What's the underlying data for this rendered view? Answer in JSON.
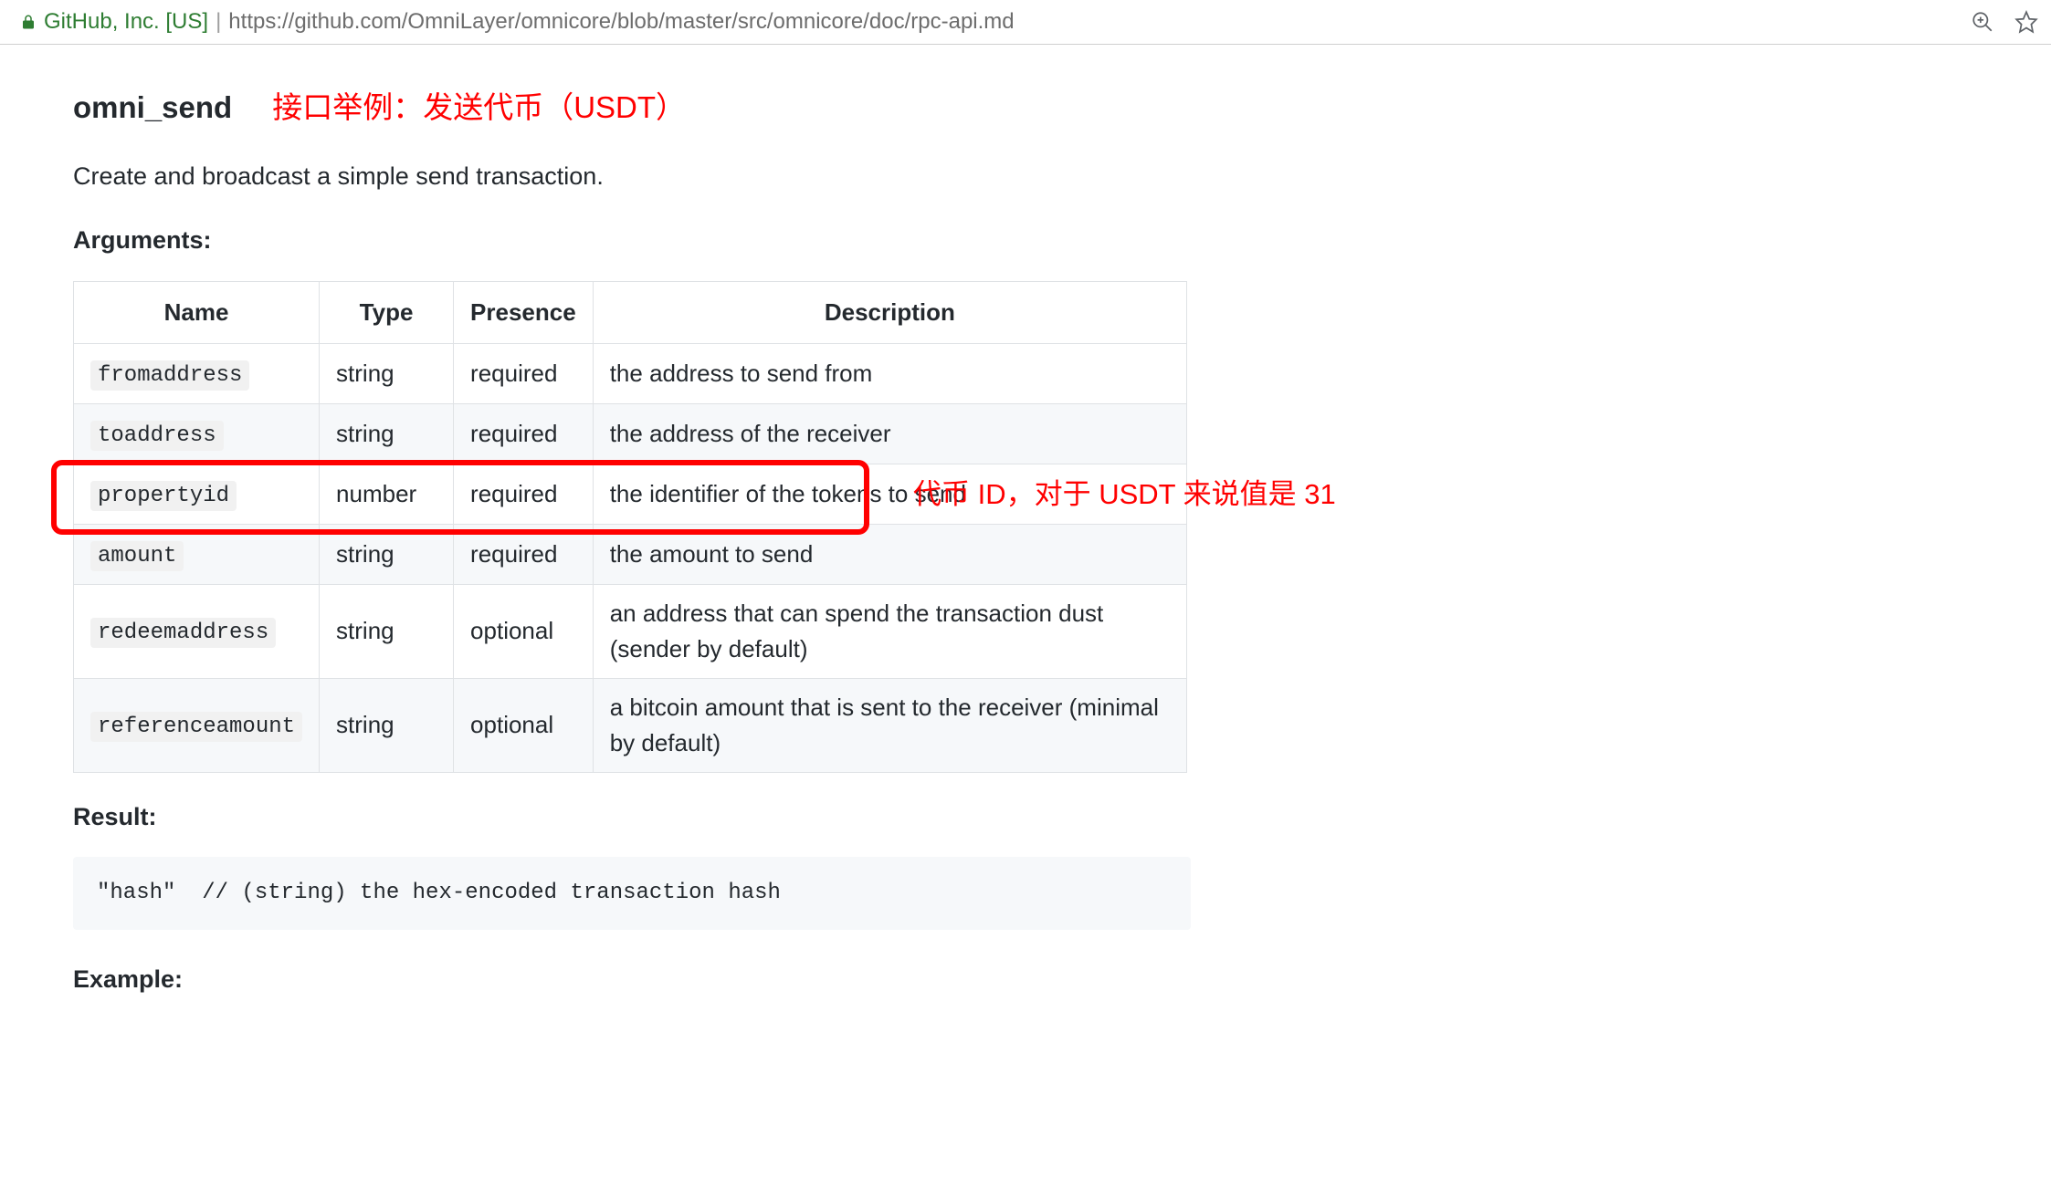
{
  "browser": {
    "company": "GitHub, Inc. [US]",
    "url": "https://github.com/OmniLayer/omnicore/blob/master/src/omnicore/doc/rpc-api.md"
  },
  "heading": {
    "api": "omni_send",
    "annotation": "接口举例：发送代币（USDT）"
  },
  "description": "Create and broadcast a simple send transaction.",
  "labels": {
    "arguments": "Arguments:",
    "result": "Result:",
    "example": "Example:"
  },
  "table": {
    "headers": {
      "name": "Name",
      "type": "Type",
      "presence": "Presence",
      "description": "Description"
    },
    "rows": [
      {
        "name": "fromaddress",
        "type": "string",
        "presence": "required",
        "description": "the address to send from"
      },
      {
        "name": "toaddress",
        "type": "string",
        "presence": "required",
        "description": "the address of the receiver"
      },
      {
        "name": "propertyid",
        "type": "number",
        "presence": "required",
        "description": "the identifier of the tokens to send"
      },
      {
        "name": "amount",
        "type": "string",
        "presence": "required",
        "description": "the amount to send"
      },
      {
        "name": "redeemaddress",
        "type": "string",
        "presence": "optional",
        "description": "an address that can spend the transaction dust (sender by default)"
      },
      {
        "name": "referenceamount",
        "type": "string",
        "presence": "optional",
        "description": "a bitcoin amount that is sent to the receiver (minimal by default)"
      }
    ],
    "highlight_row_index": 2,
    "highlight_annotation": "代币 ID，对于 USDT 来说值是 31"
  },
  "result_code": "\"hash\"  // (string) the hex-encoded transaction hash"
}
